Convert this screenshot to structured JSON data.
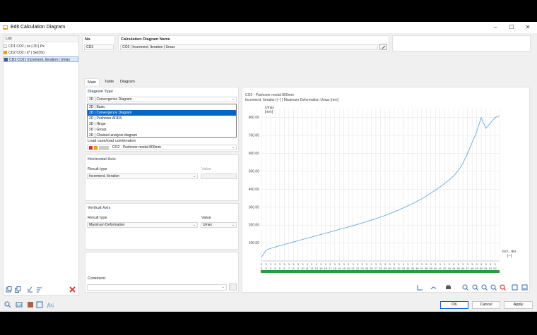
{
  "window": {
    "title": "Edit Calculation Diagram"
  },
  "list": {
    "header": "List",
    "items": [
      {
        "label": "CD1  CO2 | ux | 20 | Px",
        "color": "#ffffff"
      },
      {
        "label": "CD2  CO2 | d* | Se(DS)",
        "color": "#f0a000"
      },
      {
        "label": "CD3  CO2 | Increment, Iteration | Umax",
        "color": "#4a5a8a"
      }
    ]
  },
  "header": {
    "no_label": "No.",
    "no_value": "CD3",
    "name_label": "Calculation Diagram Name",
    "name_value": "CO2 | Increment, Iteration | Umax"
  },
  "tabs": [
    "Main",
    "Table",
    "Diagram"
  ],
  "diagram_type": {
    "title": "Diagram Type",
    "selected": "2D | Convergence Diagram",
    "options": [
      "2D | Basic",
      "2D | Convergence Diagram",
      "2D | Pushover ADRS",
      "2D | Hinge",
      "2D | Group",
      "2D | Chained analysis diagram"
    ],
    "selected_index": 1
  },
  "load_case": {
    "label": "Load case/load combination",
    "value": "CO2 - Pushover modal 800mm"
  },
  "horizontal_axis": {
    "title": "Horizontal Axis",
    "result_type_label": "Result type",
    "result_type_value": "Increment, Iteration",
    "value_label": "Value",
    "value_value": ""
  },
  "vertical_axis": {
    "title": "Vertical Axis",
    "result_type_label": "Result type",
    "result_type_value": "Maximum Deformation",
    "value_label": "Value",
    "value_value": "Umax"
  },
  "comment": {
    "label": "Comment",
    "value": ""
  },
  "buttons": {
    "ok": "OK",
    "cancel": "Cancel",
    "apply": "Apply"
  },
  "chart_data": {
    "type": "line",
    "title": "CO2 - Pushover modal 800mm",
    "subtitle": "Increment, Iteration [--] | Maximum Deformation Umax [mm]",
    "ylabel": "Umax\n[mm]",
    "xlabel": "Incr., Iter.\n[--]",
    "ylim": [
      0,
      850
    ],
    "yticks": [
      "100.00",
      "200.00",
      "300.00",
      "400.00",
      "500.00",
      "600.00",
      "700.00",
      "800.00"
    ],
    "grid": true,
    "series_color": "#5aa0dc",
    "x_top": [
      "1",
      "2",
      "3",
      "4",
      "5",
      "6",
      "7",
      "8",
      "9",
      "10",
      "11",
      "12",
      "13",
      "14",
      "15",
      "16",
      "17",
      "18",
      "19",
      "20",
      "21",
      "22",
      "23",
      "24",
      "25",
      "26",
      "27",
      "28",
      "29",
      "30",
      "31",
      "32",
      "33",
      "34",
      "35",
      "36",
      "37",
      "38",
      "39",
      "40",
      "41",
      "42",
      "43",
      "44",
      "45",
      "46",
      "47",
      "48",
      "49",
      "50",
      "51",
      "52"
    ],
    "x_bottom": [
      "3",
      "3",
      "4",
      "5",
      "5",
      "6",
      "7",
      "8",
      "9",
      "10",
      "11",
      "13",
      "13",
      "15",
      "16",
      "17",
      "18",
      "19",
      "19",
      "20",
      "21",
      "22",
      "23",
      "25",
      "26",
      "27",
      "28",
      "29",
      "30",
      "31",
      "32",
      "33",
      "34",
      "35",
      "36",
      "37",
      "38",
      "39",
      "40",
      "41",
      "42",
      "43",
      "44",
      "45",
      "46",
      "47",
      "48",
      "49",
      "50",
      "51",
      "51",
      "52"
    ],
    "values": [
      20,
      60,
      70,
      78,
      85,
      92,
      99,
      106,
      113,
      120,
      127,
      134,
      141,
      148,
      155,
      162,
      169,
      176,
      183,
      190,
      197,
      204,
      212,
      220,
      228,
      236,
      245,
      254,
      264,
      274,
      285,
      296,
      308,
      320,
      333,
      347,
      362,
      378,
      395,
      413,
      432,
      452,
      475,
      505,
      545,
      600,
      660,
      720,
      800,
      740,
      770,
      800,
      810
    ]
  }
}
